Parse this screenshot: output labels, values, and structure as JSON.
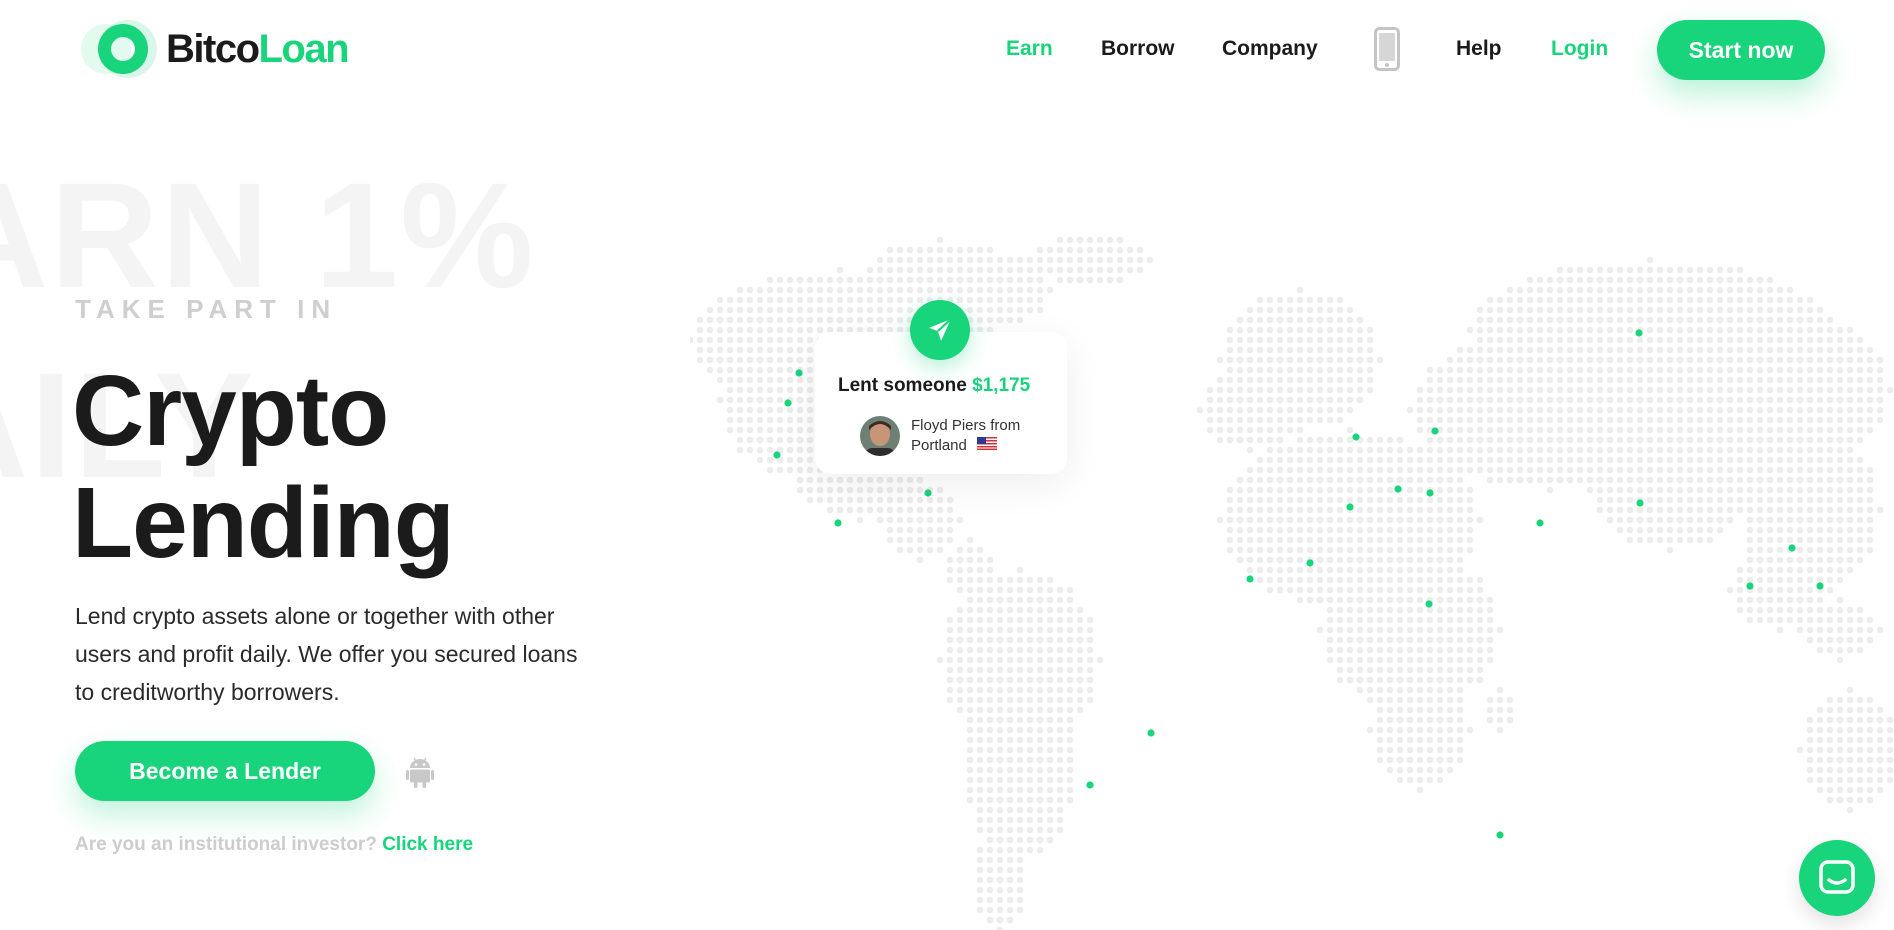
{
  "brand": {
    "name_part1": "Bitco",
    "name_part2": "Loan",
    "accent_color": "#18d47b"
  },
  "nav": {
    "items": [
      {
        "label": "Earn",
        "active": true
      },
      {
        "label": "Borrow",
        "active": false
      },
      {
        "label": "Company",
        "active": false
      },
      {
        "label": "Help",
        "active": false
      },
      {
        "label": "Login",
        "active": true
      }
    ],
    "mobile_icon": "mobile-phone-icon",
    "cta_label": "Start now"
  },
  "hero": {
    "background_words": [
      "ARN 1%",
      "AILY"
    ],
    "eyebrow": "TAKE PART IN",
    "headline_line1": "Crypto",
    "headline_line2": "Lending",
    "description": "Lend crypto assets alone or together with other users and profit daily. We offer you secured loans to creditworthy borrowers.",
    "cta_label": "Become a Lender",
    "platform_icon": "android-icon",
    "institutional_text": "Are you an institutional investor?",
    "institutional_link": "Click here"
  },
  "activity_card": {
    "title_prefix": "Lent someone",
    "amount": "$1,175",
    "person_name": "Floyd Piers from",
    "person_location": "Portland",
    "flag": "us-flag-icon",
    "badge_icon": "send-icon"
  },
  "chat": {
    "icon": "chat-icon"
  }
}
